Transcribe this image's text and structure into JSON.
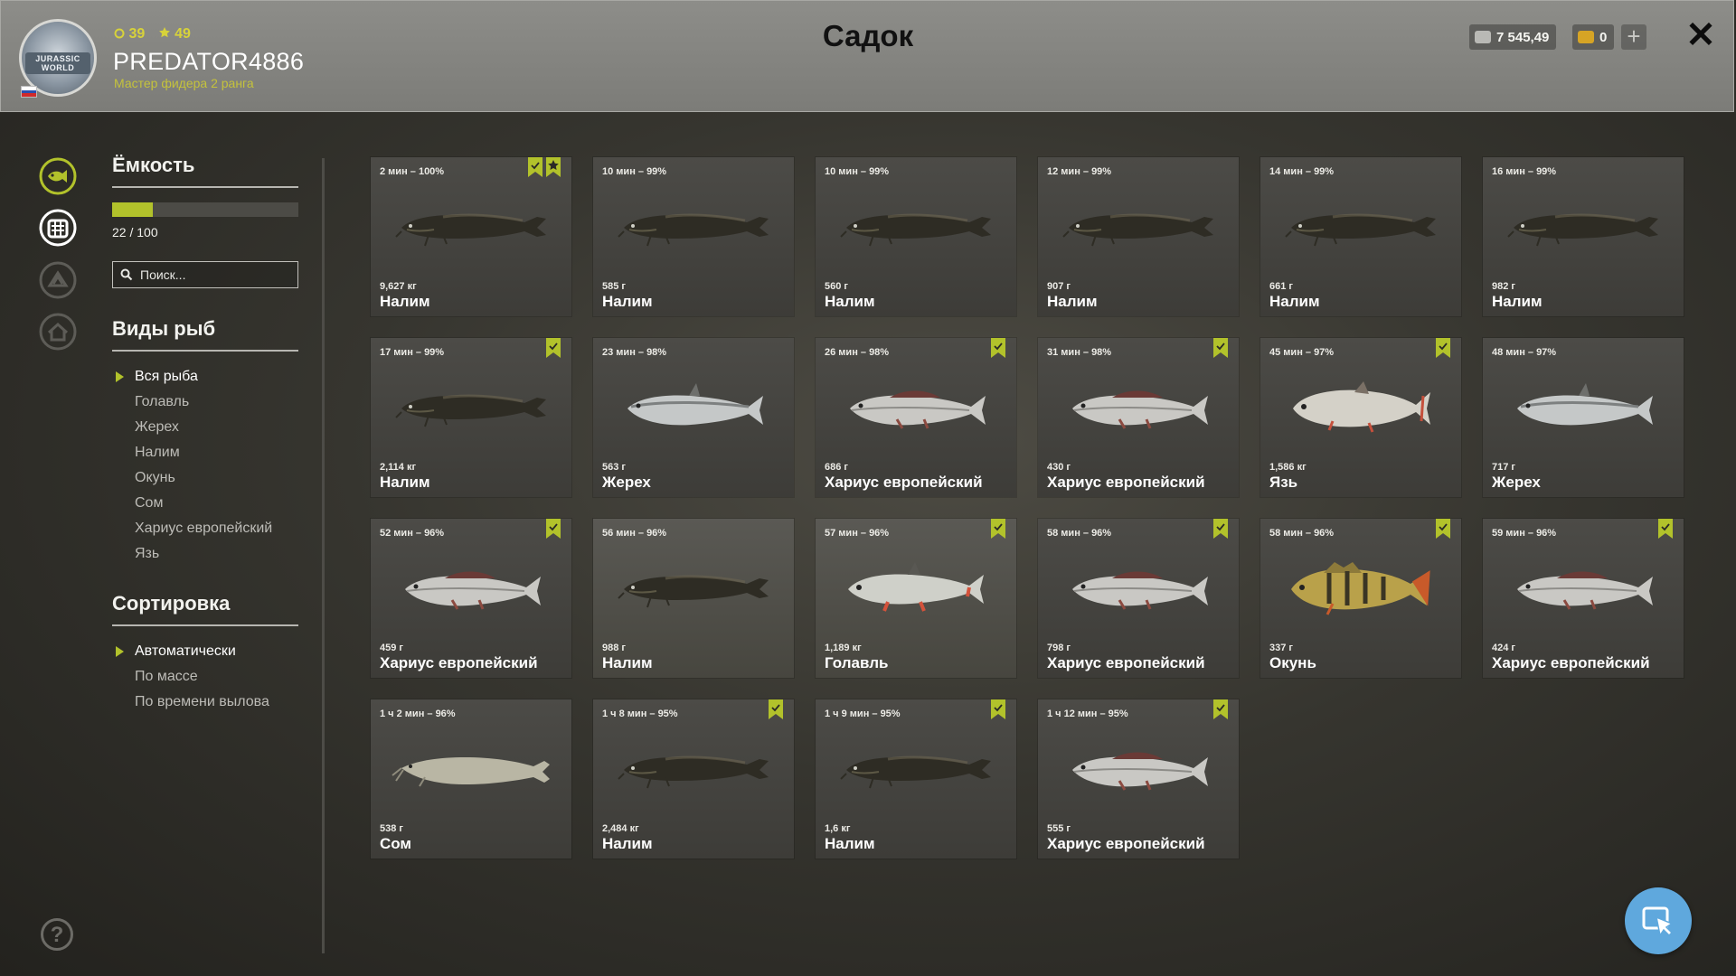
{
  "header": {
    "title": "Садок",
    "avatar_text": "JURASSIC WORLD",
    "player": {
      "level": "39",
      "rank_level": "49",
      "username": "PREDATOR4886",
      "rank": "Мастер фидера 2 ранга"
    },
    "silver": "7 545,49",
    "gold": "0",
    "plus_label": "+",
    "close_label": "✕"
  },
  "sidebar": {
    "icons": [
      "fish-icon",
      "keepnet-icon",
      "tackle-icon",
      "home-icon"
    ],
    "help_label": "?"
  },
  "panel": {
    "capacity_title": "Ёмкость",
    "capacity_current": 22,
    "capacity_max": 100,
    "capacity_text": "22 / 100",
    "search_placeholder": "Поиск...",
    "species_title": "Виды рыб",
    "species": [
      "Вся рыба",
      "Голавль",
      "Жерех",
      "Налим",
      "Окунь",
      "Сом",
      "Хариус европейский",
      "Язь"
    ],
    "species_active": 0,
    "sort_title": "Сортировка",
    "sort_options": [
      "Автоматически",
      "По массе",
      "По времени вылова"
    ],
    "sort_active": 0
  },
  "colors": {
    "accent": "#b2c22b",
    "bookmark": "#b2c22b",
    "header": "#85857f",
    "cursor_button": "#5fa8dd"
  },
  "fish": [
    {
      "time": "2 мин – 100%",
      "weight": "9,627 кг",
      "name": "Налим",
      "kind": "burbot",
      "marks": [
        "bookmark",
        "star"
      ]
    },
    {
      "time": "10 мин – 99%",
      "weight": "585 г",
      "name": "Налим",
      "kind": "burbot",
      "marks": []
    },
    {
      "time": "10 мин – 99%",
      "weight": "560 г",
      "name": "Налим",
      "kind": "burbot",
      "marks": []
    },
    {
      "time": "12 мин – 99%",
      "weight": "907 г",
      "name": "Налим",
      "kind": "burbot",
      "marks": []
    },
    {
      "time": "14 мин – 99%",
      "weight": "661 г",
      "name": "Налим",
      "kind": "burbot",
      "marks": []
    },
    {
      "time": "16 мин – 99%",
      "weight": "982 г",
      "name": "Налим",
      "kind": "burbot",
      "marks": []
    },
    {
      "time": "17 мин – 99%",
      "weight": "2,114 кг",
      "name": "Налим",
      "kind": "burbot",
      "marks": [
        "bookmark"
      ]
    },
    {
      "time": "23 мин – 98%",
      "weight": "563 г",
      "name": "Жерех",
      "kind": "asp",
      "marks": []
    },
    {
      "time": "26 мин – 98%",
      "weight": "686 г",
      "name": "Хариус европейский",
      "kind": "grayling",
      "marks": [
        "bookmark"
      ]
    },
    {
      "time": "31 мин – 98%",
      "weight": "430 г",
      "name": "Хариус европейский",
      "kind": "grayling",
      "marks": [
        "bookmark"
      ]
    },
    {
      "time": "45 мин – 97%",
      "weight": "1,586 кг",
      "name": "Язь",
      "kind": "ide",
      "marks": [
        "bookmark"
      ]
    },
    {
      "time": "48 мин – 97%",
      "weight": "717 г",
      "name": "Жерех",
      "kind": "asp",
      "marks": []
    },
    {
      "time": "52 мин – 96%",
      "weight": "459 г",
      "name": "Хариус европейский",
      "kind": "grayling",
      "marks": [
        "bookmark"
      ]
    },
    {
      "time": "56 мин – 96%",
      "weight": "988 г",
      "name": "Налим",
      "kind": "burbot",
      "marks": []
    },
    {
      "time": "57 мин – 96%",
      "weight": "1,189 кг",
      "name": "Голавль",
      "kind": "chub",
      "marks": [
        "bookmark"
      ]
    },
    {
      "time": "58 мин – 96%",
      "weight": "798 г",
      "name": "Хариус европейский",
      "kind": "grayling",
      "marks": [
        "bookmark"
      ]
    },
    {
      "time": "58 мин – 96%",
      "weight": "337 г",
      "name": "Окунь",
      "kind": "perch",
      "marks": [
        "bookmark"
      ]
    },
    {
      "time": "59 мин – 96%",
      "weight": "424 г",
      "name": "Хариус европейский",
      "kind": "grayling",
      "marks": [
        "bookmark"
      ]
    },
    {
      "time": "1 ч 2 мин – 96%",
      "weight": "538 г",
      "name": "Сом",
      "kind": "catfish",
      "marks": []
    },
    {
      "time": "1 ч 8 мин – 95%",
      "weight": "2,484 кг",
      "name": "Налим",
      "kind": "burbot",
      "marks": [
        "bookmark"
      ]
    },
    {
      "time": "1 ч 9 мин – 95%",
      "weight": "1,6 кг",
      "name": "Налим",
      "kind": "burbot",
      "marks": [
        "bookmark"
      ]
    },
    {
      "time": "1 ч 12 мин – 95%",
      "weight": "555 г",
      "name": "Хариус европейский",
      "kind": "grayling",
      "marks": [
        "bookmark"
      ]
    }
  ]
}
